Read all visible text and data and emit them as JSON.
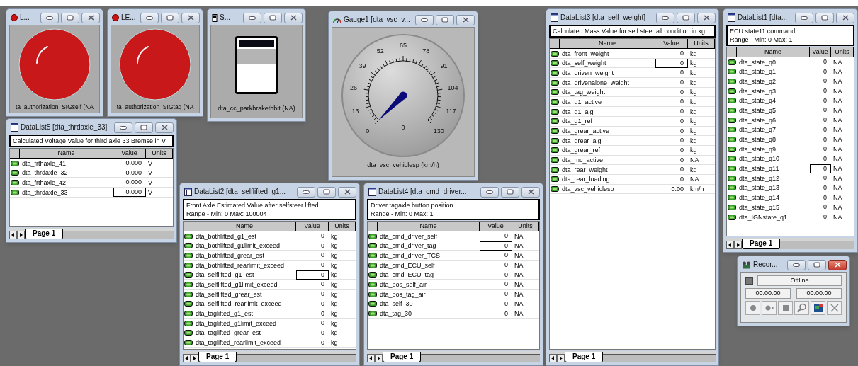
{
  "windows": [
    {
      "kind": "led",
      "title": "L...",
      "on": true,
      "caption": "ta_authorization_SIGself (NA"
    },
    {
      "kind": "led",
      "title": "LE...",
      "on": true,
      "caption": "ta_authorization_SIGtag (NA"
    },
    {
      "kind": "switch",
      "title": "S...",
      "caption": "dta_cc_parkbrakethbit (NA)"
    },
    {
      "kind": "datalist",
      "title": "DataList5 [dta_thrdaxle_33]",
      "description": [
        "Calculated Voltage Value for third axle 33 Bremse in V"
      ],
      "columns": [
        "Name",
        "Value",
        "Units"
      ],
      "rows": [
        {
          "name": "dta_frthaxle_41",
          "value": "0.000",
          "units": "V",
          "selected": false
        },
        {
          "name": "dta_thrdaxle_32",
          "value": "0.000",
          "units": "V",
          "selected": false
        },
        {
          "name": "dta_frthaxle_42",
          "value": "0.000",
          "units": "V",
          "selected": false
        },
        {
          "name": "dta_thrdaxle_33",
          "value": "0.000",
          "units": "V",
          "selected": true
        }
      ],
      "tabs": [
        {
          "label": "Page 1",
          "selected": true
        }
      ]
    },
    {
      "kind": "gauge",
      "title": "Gauge1 [dta_vsc_v...",
      "scale": [
        "0",
        "13",
        "26",
        "39",
        "52",
        "65",
        "78",
        "91",
        "104",
        "117",
        "130"
      ],
      "reading": "0",
      "caption": "dta_vsc_vehiclesp (km/h)"
    },
    {
      "kind": "datalist",
      "title": "DataList2 [dta_selflifted_g1...",
      "description": [
        "Front Axle Estimated Value after selfsteer lifted",
        "Range -  Min: 0   Max: 100004"
      ],
      "columns": [
        "Name",
        "Value",
        "Units"
      ],
      "rows": [
        {
          "name": "dta_bothlifted_g1_est",
          "value": "0",
          "units": "kg",
          "selected": false
        },
        {
          "name": "dta_bothlifted_g1limit_exceed",
          "value": "0",
          "units": "kg",
          "selected": false
        },
        {
          "name": "dta_bothlifted_grear_est",
          "value": "0",
          "units": "kg",
          "selected": false
        },
        {
          "name": "dta_bothlifted_rearlimit_exceed",
          "value": "0",
          "units": "kg",
          "selected": false
        },
        {
          "name": "dta_selflifted_g1_est",
          "value": "0",
          "units": "kg",
          "selected": true
        },
        {
          "name": "dta_selflifted_g1limit_exceed",
          "value": "0",
          "units": "kg",
          "selected": false
        },
        {
          "name": "dta_selflifted_grear_est",
          "value": "0",
          "units": "kg",
          "selected": false
        },
        {
          "name": "dta_selflifted_rearlimit_exceed",
          "value": "0",
          "units": "kg",
          "selected": false
        },
        {
          "name": "dta_taglifted_g1_est",
          "value": "0",
          "units": "kg",
          "selected": false
        },
        {
          "name": "dta_taglifted_g1limit_exceed",
          "value": "0",
          "units": "kg",
          "selected": false
        },
        {
          "name": "dta_taglifted_grear_est",
          "value": "0",
          "units": "kg",
          "selected": false
        },
        {
          "name": "dta_taglifted_rearlimit_exceed",
          "value": "0",
          "units": "kg",
          "selected": false
        }
      ],
      "tabs": [
        {
          "label": "Page 1",
          "selected": true
        }
      ]
    },
    {
      "kind": "datalist",
      "title": "DataList4 [dta_cmd_driver...",
      "description": [
        "Driver tagaxle button position",
        "Range -  Min: 0   Max: 1"
      ],
      "columns": [
        "Name",
        "Value",
        "Units"
      ],
      "rows": [
        {
          "name": "dta_cmd_driver_self",
          "value": "0",
          "units": "NA",
          "selected": false
        },
        {
          "name": "dta_cmd_driver_tag",
          "value": "0",
          "units": "NA",
          "selected": true
        },
        {
          "name": "dta_cmd_driver_TCS",
          "value": "0",
          "units": "NA",
          "selected": false
        },
        {
          "name": "dta_cmd_ECU_self",
          "value": "0",
          "units": "NA",
          "selected": false
        },
        {
          "name": "dta_cmd_ECU_tag",
          "value": "0",
          "units": "NA",
          "selected": false
        },
        {
          "name": "dta_pos_self_air",
          "value": "0",
          "units": "NA",
          "selected": false
        },
        {
          "name": "dta_pos_tag_air",
          "value": "0",
          "units": "NA",
          "selected": false
        },
        {
          "name": "dta_self_30",
          "value": "0",
          "units": "NA",
          "selected": false
        },
        {
          "name": "dta_tag_30",
          "value": "0",
          "units": "NA",
          "selected": false
        }
      ],
      "tabs": [
        {
          "label": "Page 1",
          "selected": true
        }
      ]
    },
    {
      "kind": "datalist",
      "title": "DataList3 [dta_self_weight]",
      "description": [
        "Calculated Mass Value for self steer all condition in kg"
      ],
      "columns": [
        "Name",
        "Value",
        "Units"
      ],
      "rows": [
        {
          "name": "dta_front_weight",
          "value": "0",
          "units": "kg",
          "selected": false
        },
        {
          "name": "dta_self_weight",
          "value": "0",
          "units": "kg",
          "selected": true
        },
        {
          "name": "dta_driven_weight",
          "value": "0",
          "units": "kg",
          "selected": false
        },
        {
          "name": "dta_drivenalone_weight",
          "value": "0",
          "units": "kg",
          "selected": false
        },
        {
          "name": "dta_tag_weight",
          "value": "0",
          "units": "kg",
          "selected": false
        },
        {
          "name": "dta_g1_active",
          "value": "0",
          "units": "kg",
          "selected": false
        },
        {
          "name": "dta_g1_alg",
          "value": "0",
          "units": "kg",
          "selected": false
        },
        {
          "name": "dta_g1_ref",
          "value": "0",
          "units": "kg",
          "selected": false
        },
        {
          "name": "dta_grear_active",
          "value": "0",
          "units": "kg",
          "selected": false
        },
        {
          "name": "dta_grear_alg",
          "value": "0",
          "units": "kg",
          "selected": false
        },
        {
          "name": "dta_grear_ref",
          "value": "0",
          "units": "kg",
          "selected": false
        },
        {
          "name": "dta_mc_active",
          "value": "0",
          "units": "NA",
          "selected": false
        },
        {
          "name": "dta_rear_weight",
          "value": "0",
          "units": "kg",
          "selected": false
        },
        {
          "name": "dta_rear_loading",
          "value": "0",
          "units": "NA",
          "selected": false
        },
        {
          "name": "dta_vsc_vehiclesp",
          "value": "0.00",
          "units": "km/h",
          "selected": false
        }
      ],
      "tabs": [
        {
          "label": "Page 1",
          "selected": true
        }
      ]
    },
    {
      "kind": "datalist",
      "title": "DataList1 [dta...",
      "description": [
        "ECU state11 command",
        "Range -  Min: 0   Max: 1"
      ],
      "columns": [
        "Name",
        "Value",
        "Units"
      ],
      "rows": [
        {
          "name": "dta_state_q0",
          "value": "0",
          "units": "NA",
          "selected": false
        },
        {
          "name": "dta_state_q1",
          "value": "0",
          "units": "NA",
          "selected": false
        },
        {
          "name": "dta_state_q2",
          "value": "0",
          "units": "NA",
          "selected": false
        },
        {
          "name": "dta_state_q3",
          "value": "0",
          "units": "NA",
          "selected": false
        },
        {
          "name": "dta_state_q4",
          "value": "0",
          "units": "NA",
          "selected": false
        },
        {
          "name": "dta_state_q5",
          "value": "0",
          "units": "NA",
          "selected": false
        },
        {
          "name": "dta_state_q6",
          "value": "0",
          "units": "NA",
          "selected": false
        },
        {
          "name": "dta_state_q7",
          "value": "0",
          "units": "NA",
          "selected": false
        },
        {
          "name": "dta_state_q8",
          "value": "0",
          "units": "NA",
          "selected": false
        },
        {
          "name": "dta_state_q9",
          "value": "0",
          "units": "NA",
          "selected": false
        },
        {
          "name": "dta_state_q10",
          "value": "0",
          "units": "NA",
          "selected": false
        },
        {
          "name": "dta_state_q11",
          "value": "0",
          "units": "NA",
          "selected": true
        },
        {
          "name": "dta_state_q12",
          "value": "0",
          "units": "NA",
          "selected": false
        },
        {
          "name": "dta_state_q13",
          "value": "0",
          "units": "NA",
          "selected": false
        },
        {
          "name": "dta_state_q14",
          "value": "0",
          "units": "NA",
          "selected": false
        },
        {
          "name": "dta_state_q15",
          "value": "0",
          "units": "NA",
          "selected": false
        },
        {
          "name": "dta_IGNstate_q1",
          "value": "0",
          "units": "NA",
          "selected": false
        }
      ],
      "tabs": [
        {
          "label": "Page 1",
          "selected": true
        }
      ]
    },
    {
      "kind": "recorder",
      "title": "Recor...",
      "status": "Offline",
      "times": [
        "00:00:00",
        "00:00:00"
      ]
    }
  ]
}
